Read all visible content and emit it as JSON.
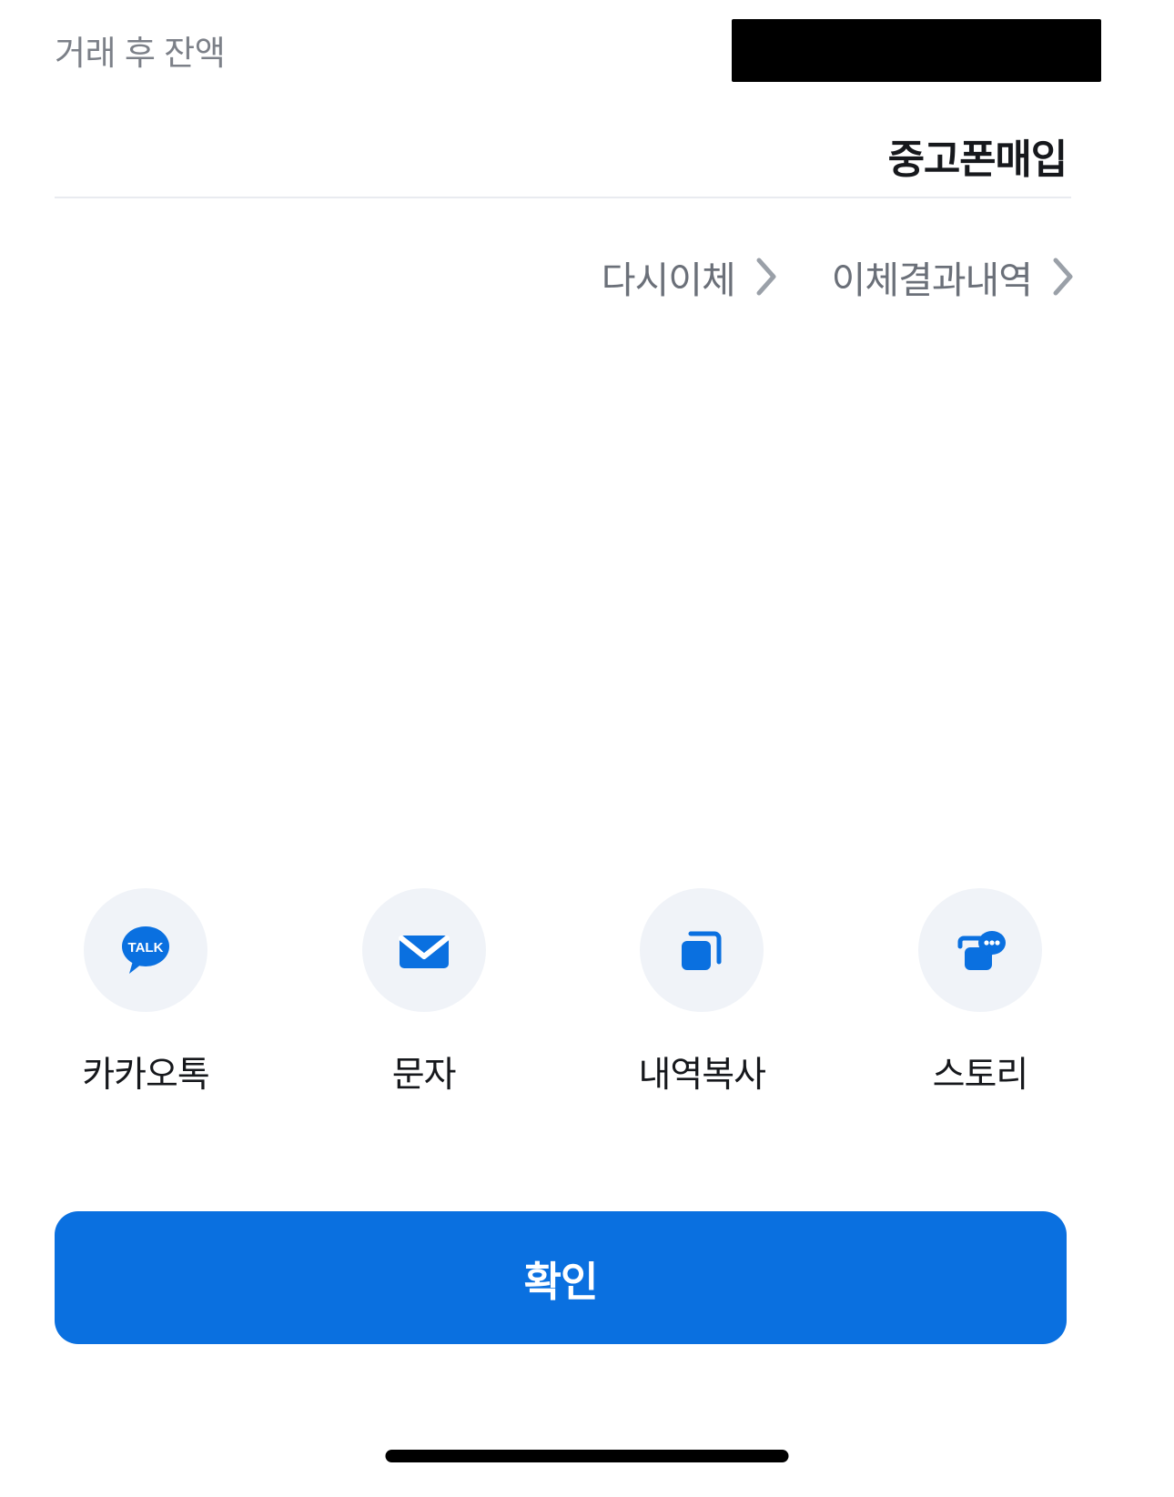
{
  "summary": {
    "label": "거래 후 잔액",
    "value_redacted": true,
    "value_text": ""
  },
  "merchant": {
    "name": "중고폰매입"
  },
  "quick_links": [
    {
      "label": "다시이체",
      "icon": "chevron-right-icon"
    },
    {
      "label": "이체결과내역",
      "icon": "chevron-right-icon"
    }
  ],
  "share_actions": [
    {
      "label": "카카오톡",
      "icon": "kakaotalk-icon"
    },
    {
      "label": "문자",
      "icon": "envelope-icon"
    },
    {
      "label": "내역복사",
      "icon": "copy-icon"
    },
    {
      "label": "스토리",
      "icon": "story-chat-icon"
    }
  ],
  "confirm_button": {
    "label": "확인"
  },
  "colors": {
    "accent_blue": "#0a70e0",
    "icon_circle_bg": "#f0f3f8",
    "label_gray": "#7c8088",
    "link_gray": "#6b7079",
    "text_dark": "#16181c",
    "divider": "#e9ebf0"
  }
}
